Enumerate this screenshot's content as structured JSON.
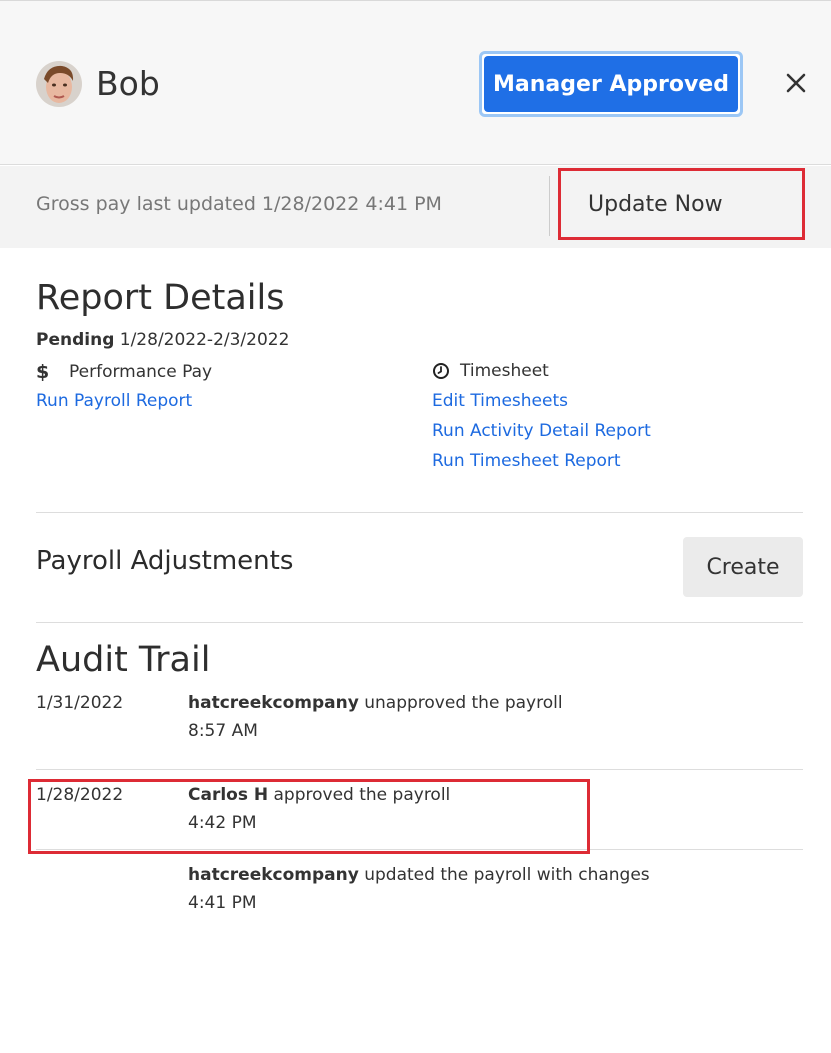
{
  "header": {
    "user_name": "Bob",
    "status_button": "Manager Approved",
    "close_icon": "close-icon",
    "accent_color": "#1f6fe6"
  },
  "update_bar": {
    "gross_pay_text": "Gross pay last updated 1/28/2022 4:41 PM",
    "update_button": "Update Now"
  },
  "report_details": {
    "title": "Report Details",
    "status_label": "Pending",
    "date_range": "1/28/2022-2/3/2022",
    "left_column": {
      "icon": "dollar-icon",
      "heading": "Performance Pay",
      "links": [
        "Run Payroll Report"
      ]
    },
    "right_column": {
      "icon": "clock-icon",
      "heading": "Timesheet",
      "links": [
        "Edit Timesheets",
        "Run Activity Detail Report",
        "Run Timesheet Report"
      ]
    }
  },
  "payroll_adjustments": {
    "title": "Payroll Adjustments",
    "create_button": "Create"
  },
  "audit_trail": {
    "title": "Audit Trail",
    "entries": [
      {
        "date": "1/31/2022",
        "actor": "hatcreekcompany",
        "action": "unapproved the payroll",
        "time": "8:57 AM"
      },
      {
        "date": "1/28/2022",
        "actor": "Carlos H",
        "action": "approved the payroll",
        "time": "4:42 PM"
      },
      {
        "date": "",
        "actor": "hatcreekcompany",
        "action": "updated the payroll with changes",
        "time": "4:41 PM"
      }
    ]
  }
}
